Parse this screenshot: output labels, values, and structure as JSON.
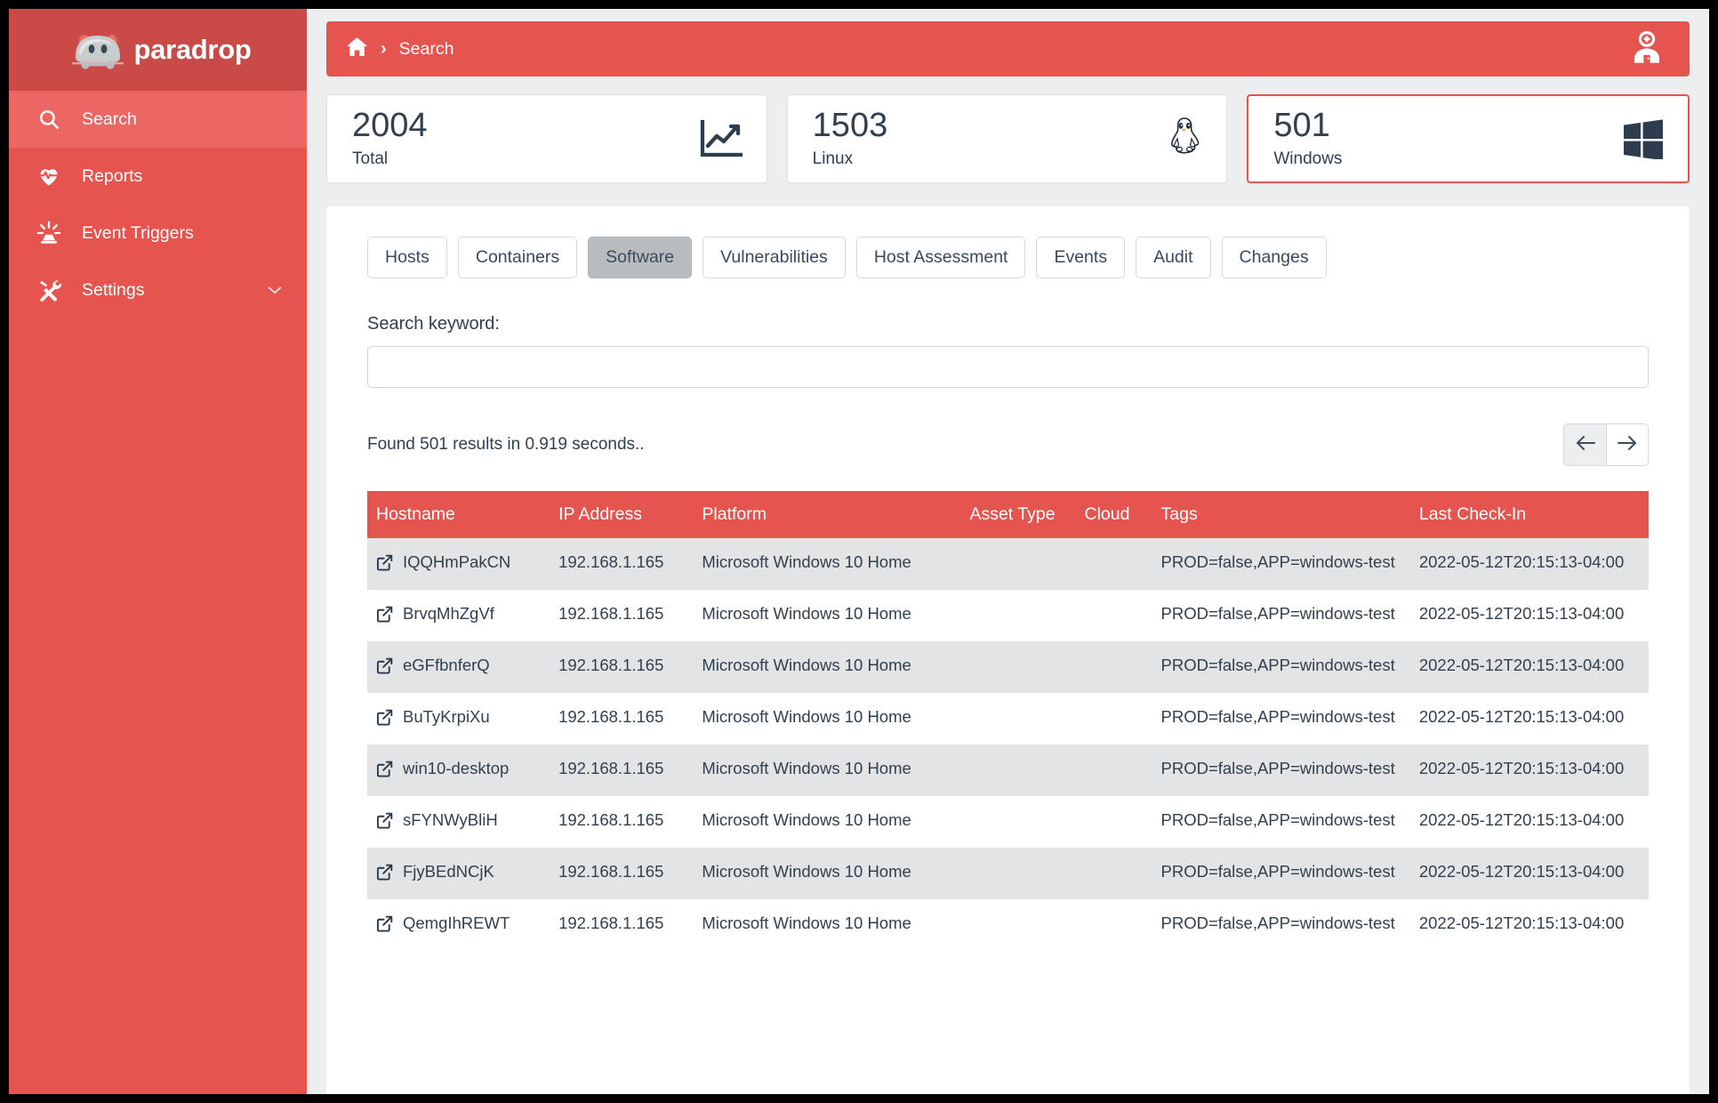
{
  "brand": {
    "name": "paradrop",
    "logo_icon": "paradrop-mascot-logo"
  },
  "sidebar": {
    "items": [
      {
        "label": "Search",
        "icon": "search-icon",
        "active": true
      },
      {
        "label": "Reports",
        "icon": "heartbeat-icon",
        "active": false
      },
      {
        "label": "Event Triggers",
        "icon": "broadcast-icon",
        "active": false
      },
      {
        "label": "Settings",
        "icon": "tools-icon",
        "active": false,
        "chevron": "chevron-down-icon"
      }
    ]
  },
  "topbar": {
    "home_icon": "home-icon",
    "separator": "›",
    "breadcrumb_current": "Search",
    "user_icon": "user-avatar-icon"
  },
  "stats": [
    {
      "value": "2004",
      "label": "Total",
      "icon": "line-chart-icon",
      "highlight": false
    },
    {
      "value": "1503",
      "label": "Linux",
      "icon": "linux-penguin-icon",
      "highlight": false
    },
    {
      "value": "501",
      "label": "Windows",
      "icon": "windows-logo-icon",
      "highlight": true
    }
  ],
  "tabs": [
    {
      "label": "Hosts",
      "active": false
    },
    {
      "label": "Containers",
      "active": false
    },
    {
      "label": "Software",
      "active": true
    },
    {
      "label": "Vulnerabilities",
      "active": false
    },
    {
      "label": "Host Assessment",
      "active": false
    },
    {
      "label": "Events",
      "active": false
    },
    {
      "label": "Audit",
      "active": false
    },
    {
      "label": "Changes",
      "active": false
    }
  ],
  "search": {
    "label": "Search keyword:",
    "value": "",
    "placeholder": ""
  },
  "results": {
    "summary": "Found 501 results in 0.919 seconds..",
    "prev_icon": "arrow-left-icon",
    "next_icon": "arrow-right-icon"
  },
  "table": {
    "columns": [
      "Hostname",
      "IP Address",
      "Platform",
      "Asset Type",
      "Cloud",
      "Tags",
      "Last Check-In"
    ],
    "rows": [
      {
        "hostname": "IQQHmPakCN",
        "ip": "192.168.1.165",
        "platform": "Microsoft Windows 10 Home",
        "asset_type": "",
        "cloud": "",
        "tags": "PROD=false,APP=windows-test",
        "last_checkin": "2022-05-12T20:15:13-04:00"
      },
      {
        "hostname": "BrvqMhZgVf",
        "ip": "192.168.1.165",
        "platform": "Microsoft Windows 10 Home",
        "asset_type": "",
        "cloud": "",
        "tags": "PROD=false,APP=windows-test",
        "last_checkin": "2022-05-12T20:15:13-04:00"
      },
      {
        "hostname": "eGFfbnferQ",
        "ip": "192.168.1.165",
        "platform": "Microsoft Windows 10 Home",
        "asset_type": "",
        "cloud": "",
        "tags": "PROD=false,APP=windows-test",
        "last_checkin": "2022-05-12T20:15:13-04:00"
      },
      {
        "hostname": "BuTyKrpiXu",
        "ip": "192.168.1.165",
        "platform": "Microsoft Windows 10 Home",
        "asset_type": "",
        "cloud": "",
        "tags": "PROD=false,APP=windows-test",
        "last_checkin": "2022-05-12T20:15:13-04:00"
      },
      {
        "hostname": "win10-desktop",
        "ip": "192.168.1.165",
        "platform": "Microsoft Windows 10 Home",
        "asset_type": "",
        "cloud": "",
        "tags": "PROD=false,APP=windows-test",
        "last_checkin": "2022-05-12T20:15:13-04:00"
      },
      {
        "hostname": "sFYNWyBliH",
        "ip": "192.168.1.165",
        "platform": "Microsoft Windows 10 Home",
        "asset_type": "",
        "cloud": "",
        "tags": "PROD=false,APP=windows-test",
        "last_checkin": "2022-05-12T20:15:13-04:00"
      },
      {
        "hostname": "FjyBEdNCjK",
        "ip": "192.168.1.165",
        "platform": "Microsoft Windows 10 Home",
        "asset_type": "",
        "cloud": "",
        "tags": "PROD=false,APP=windows-test",
        "last_checkin": "2022-05-12T20:15:13-04:00"
      },
      {
        "hostname": "QemgIhREWT",
        "ip": "192.168.1.165",
        "platform": "Microsoft Windows 10 Home",
        "asset_type": "",
        "cloud": "",
        "tags": "PROD=false,APP=windows-test",
        "last_checkin": "2022-05-12T20:15:13-04:00"
      }
    ]
  },
  "colors": {
    "brand_red": "#e6544f",
    "brand_red_dark": "#c94a47",
    "brand_red_active": "#ec6763",
    "page_bg": "#eceef0",
    "text_dark": "#32404e",
    "row_odd": "#e3e4e6",
    "tab_active": "#b9bcbf"
  }
}
